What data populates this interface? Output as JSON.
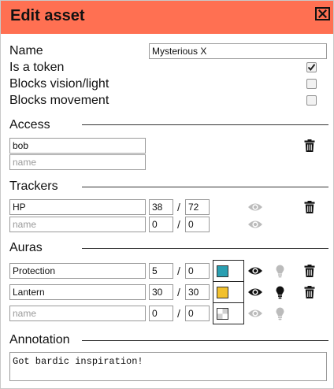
{
  "dialog": {
    "title": "Edit asset",
    "close_icon": "close-icon"
  },
  "general": {
    "name_label": "Name",
    "name_value": "Mysterious X",
    "token_label": "Is a token",
    "token_checked": true,
    "vision_label": "Blocks vision/light",
    "vision_checked": false,
    "movement_label": "Blocks movement",
    "movement_checked": false
  },
  "access": {
    "heading": "Access",
    "users": [
      {
        "value": "bob"
      }
    ],
    "new_placeholder": "name"
  },
  "trackers": {
    "heading": "Trackers",
    "rows": [
      {
        "name": "HP",
        "value": "38",
        "max": "72"
      },
      {
        "name": "",
        "name_placeholder": "name",
        "value": "0",
        "max": "0"
      }
    ]
  },
  "auras": {
    "heading": "Auras",
    "rows": [
      {
        "name": "Protection",
        "value": "5",
        "dim": "0",
        "color": "#2a9fb1",
        "visible": true,
        "light": false
      },
      {
        "name": "Lantern",
        "value": "30",
        "dim": "30",
        "color": "#f2c12e",
        "visible": true,
        "light": true
      },
      {
        "name": "",
        "name_placeholder": "name",
        "value": "0",
        "dim": "0",
        "color": "transparent",
        "visible": false,
        "light": false
      }
    ]
  },
  "annotation": {
    "heading": "Annotation",
    "text": "Got bardic inspiration!"
  },
  "colors": {
    "header": "#ff7052",
    "icon_active": "#111111",
    "icon_inactive": "#bbbbbb"
  }
}
